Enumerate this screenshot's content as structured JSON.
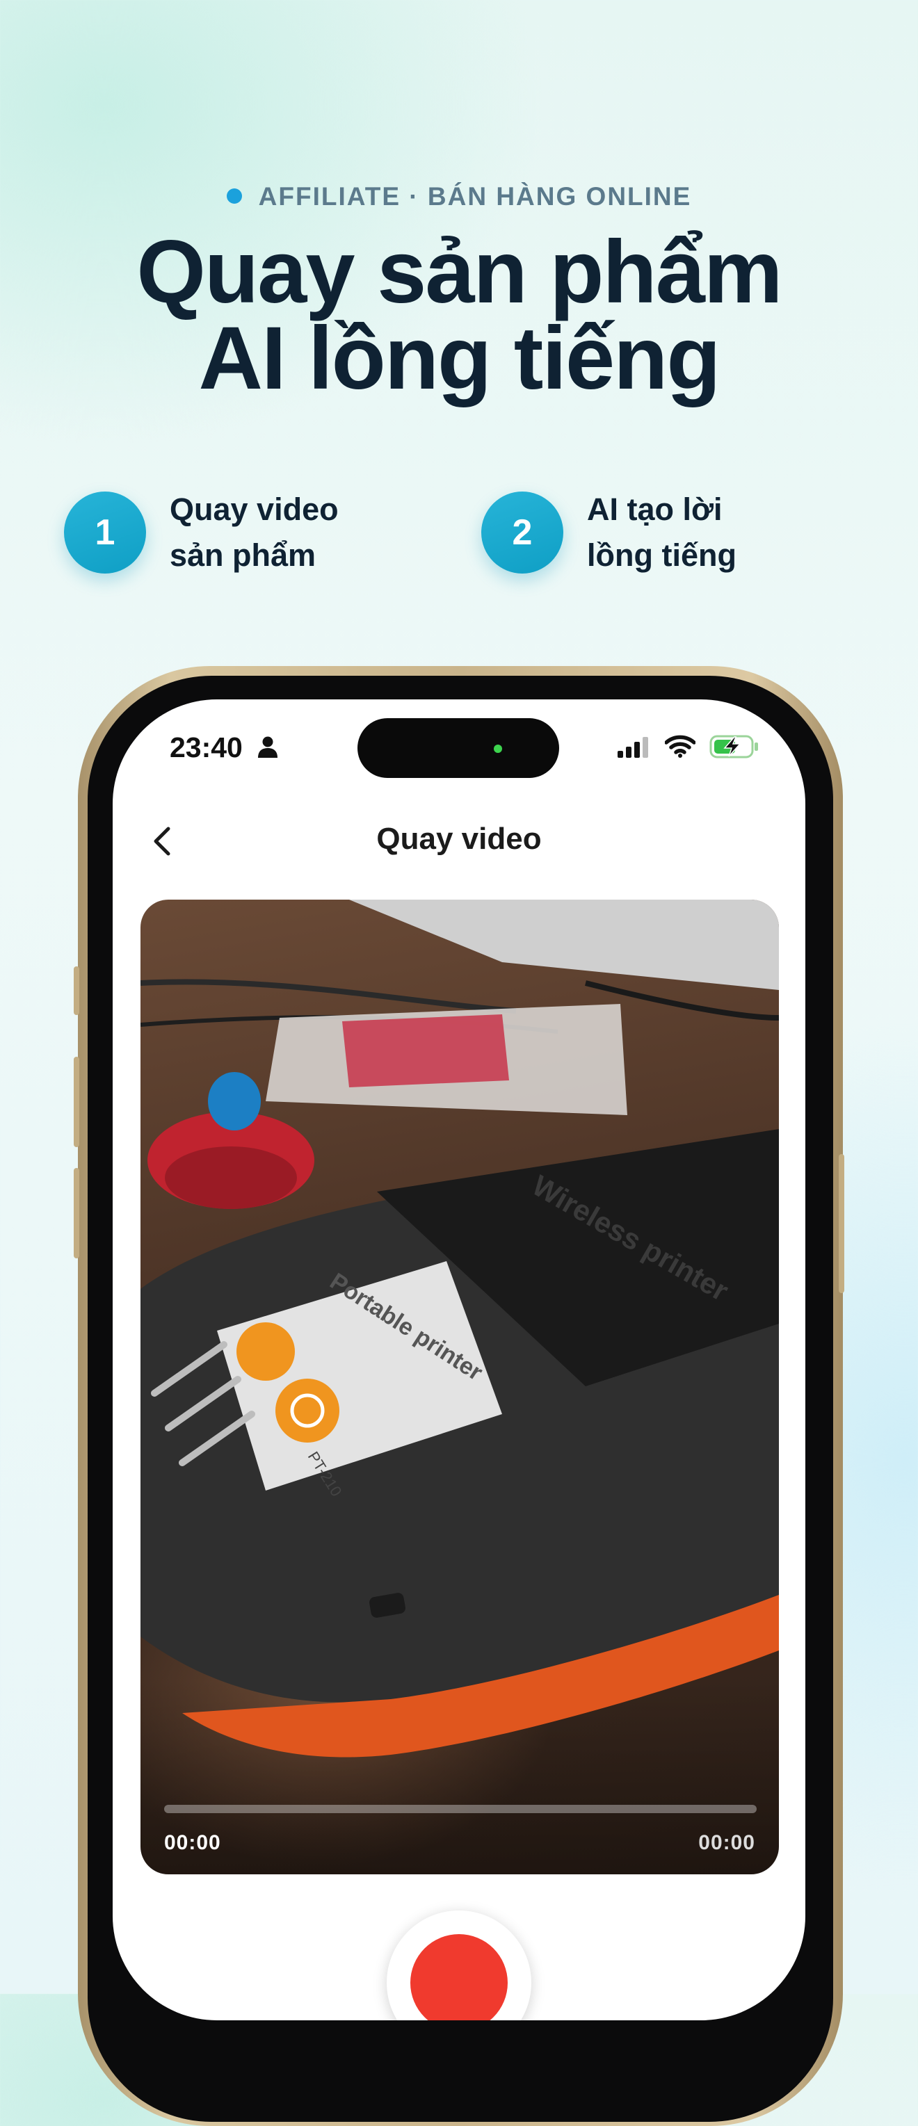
{
  "header": {
    "tagline": "AFFILIATE · BÁN HÀNG ONLINE",
    "headline_line1": "Quay sản phẩm",
    "headline_line2": "AI lồng tiếng",
    "accent_color": "#1ba1dc"
  },
  "steps": [
    {
      "number": "1",
      "line1": "Quay video",
      "line2": "sản phẩm"
    },
    {
      "number": "2",
      "line1": "AI tạo lời",
      "line2": "lồng tiếng"
    }
  ],
  "status_bar": {
    "time": "23:40",
    "icons": [
      "person-icon",
      "signal-icon",
      "wifi-icon",
      "battery-charging-icon"
    ]
  },
  "app": {
    "title": "Quay video",
    "back_icon": "chevron-left-icon",
    "video": {
      "elapsed": "00:00",
      "duration": "00:00",
      "progress": 0,
      "printer_label": "Portable printer",
      "printer_model": "PT-210",
      "printer_lid_text": "Wireless printer"
    },
    "record_color": "#f03a2e"
  }
}
